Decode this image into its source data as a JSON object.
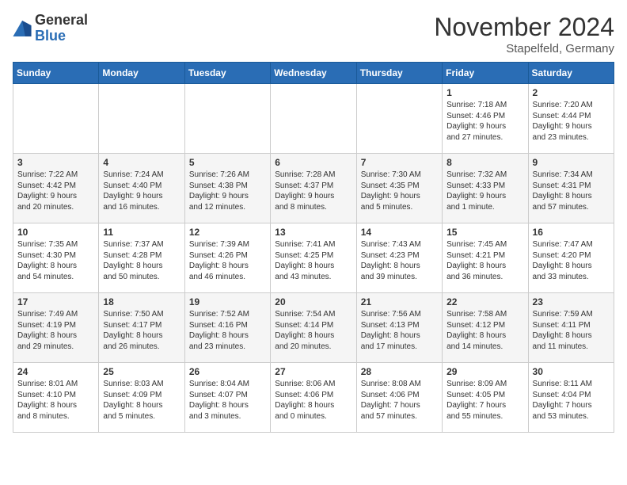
{
  "logo": {
    "general": "General",
    "blue": "Blue"
  },
  "title": "November 2024",
  "location": "Stapelfeld, Germany",
  "days_of_week": [
    "Sunday",
    "Monday",
    "Tuesday",
    "Wednesday",
    "Thursday",
    "Friday",
    "Saturday"
  ],
  "weeks": [
    [
      {
        "day": "",
        "info": ""
      },
      {
        "day": "",
        "info": ""
      },
      {
        "day": "",
        "info": ""
      },
      {
        "day": "",
        "info": ""
      },
      {
        "day": "",
        "info": ""
      },
      {
        "day": "1",
        "info": "Sunrise: 7:18 AM\nSunset: 4:46 PM\nDaylight: 9 hours\nand 27 minutes."
      },
      {
        "day": "2",
        "info": "Sunrise: 7:20 AM\nSunset: 4:44 PM\nDaylight: 9 hours\nand 23 minutes."
      }
    ],
    [
      {
        "day": "3",
        "info": "Sunrise: 7:22 AM\nSunset: 4:42 PM\nDaylight: 9 hours\nand 20 minutes."
      },
      {
        "day": "4",
        "info": "Sunrise: 7:24 AM\nSunset: 4:40 PM\nDaylight: 9 hours\nand 16 minutes."
      },
      {
        "day": "5",
        "info": "Sunrise: 7:26 AM\nSunset: 4:38 PM\nDaylight: 9 hours\nand 12 minutes."
      },
      {
        "day": "6",
        "info": "Sunrise: 7:28 AM\nSunset: 4:37 PM\nDaylight: 9 hours\nand 8 minutes."
      },
      {
        "day": "7",
        "info": "Sunrise: 7:30 AM\nSunset: 4:35 PM\nDaylight: 9 hours\nand 5 minutes."
      },
      {
        "day": "8",
        "info": "Sunrise: 7:32 AM\nSunset: 4:33 PM\nDaylight: 9 hours\nand 1 minute."
      },
      {
        "day": "9",
        "info": "Sunrise: 7:34 AM\nSunset: 4:31 PM\nDaylight: 8 hours\nand 57 minutes."
      }
    ],
    [
      {
        "day": "10",
        "info": "Sunrise: 7:35 AM\nSunset: 4:30 PM\nDaylight: 8 hours\nand 54 minutes."
      },
      {
        "day": "11",
        "info": "Sunrise: 7:37 AM\nSunset: 4:28 PM\nDaylight: 8 hours\nand 50 minutes."
      },
      {
        "day": "12",
        "info": "Sunrise: 7:39 AM\nSunset: 4:26 PM\nDaylight: 8 hours\nand 46 minutes."
      },
      {
        "day": "13",
        "info": "Sunrise: 7:41 AM\nSunset: 4:25 PM\nDaylight: 8 hours\nand 43 minutes."
      },
      {
        "day": "14",
        "info": "Sunrise: 7:43 AM\nSunset: 4:23 PM\nDaylight: 8 hours\nand 39 minutes."
      },
      {
        "day": "15",
        "info": "Sunrise: 7:45 AM\nSunset: 4:21 PM\nDaylight: 8 hours\nand 36 minutes."
      },
      {
        "day": "16",
        "info": "Sunrise: 7:47 AM\nSunset: 4:20 PM\nDaylight: 8 hours\nand 33 minutes."
      }
    ],
    [
      {
        "day": "17",
        "info": "Sunrise: 7:49 AM\nSunset: 4:19 PM\nDaylight: 8 hours\nand 29 minutes."
      },
      {
        "day": "18",
        "info": "Sunrise: 7:50 AM\nSunset: 4:17 PM\nDaylight: 8 hours\nand 26 minutes."
      },
      {
        "day": "19",
        "info": "Sunrise: 7:52 AM\nSunset: 4:16 PM\nDaylight: 8 hours\nand 23 minutes."
      },
      {
        "day": "20",
        "info": "Sunrise: 7:54 AM\nSunset: 4:14 PM\nDaylight: 8 hours\nand 20 minutes."
      },
      {
        "day": "21",
        "info": "Sunrise: 7:56 AM\nSunset: 4:13 PM\nDaylight: 8 hours\nand 17 minutes."
      },
      {
        "day": "22",
        "info": "Sunrise: 7:58 AM\nSunset: 4:12 PM\nDaylight: 8 hours\nand 14 minutes."
      },
      {
        "day": "23",
        "info": "Sunrise: 7:59 AM\nSunset: 4:11 PM\nDaylight: 8 hours\nand 11 minutes."
      }
    ],
    [
      {
        "day": "24",
        "info": "Sunrise: 8:01 AM\nSunset: 4:10 PM\nDaylight: 8 hours\nand 8 minutes."
      },
      {
        "day": "25",
        "info": "Sunrise: 8:03 AM\nSunset: 4:09 PM\nDaylight: 8 hours\nand 5 minutes."
      },
      {
        "day": "26",
        "info": "Sunrise: 8:04 AM\nSunset: 4:07 PM\nDaylight: 8 hours\nand 3 minutes."
      },
      {
        "day": "27",
        "info": "Sunrise: 8:06 AM\nSunset: 4:06 PM\nDaylight: 8 hours\nand 0 minutes."
      },
      {
        "day": "28",
        "info": "Sunrise: 8:08 AM\nSunset: 4:06 PM\nDaylight: 7 hours\nand 57 minutes."
      },
      {
        "day": "29",
        "info": "Sunrise: 8:09 AM\nSunset: 4:05 PM\nDaylight: 7 hours\nand 55 minutes."
      },
      {
        "day": "30",
        "info": "Sunrise: 8:11 AM\nSunset: 4:04 PM\nDaylight: 7 hours\nand 53 minutes."
      }
    ]
  ]
}
